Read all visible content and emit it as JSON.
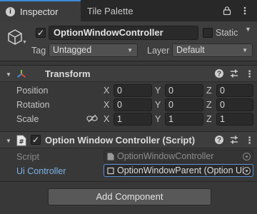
{
  "tabs": {
    "inspector": "Inspector",
    "tile_palette": "Tile Palette"
  },
  "gameobject": {
    "active": true,
    "name": "OptionWindowController",
    "static_label": "Static",
    "static_checked": false,
    "tag_label": "Tag",
    "tag_value": "Untagged",
    "layer_label": "Layer",
    "layer_value": "Default"
  },
  "transform": {
    "title": "Transform",
    "position": {
      "label": "Position",
      "x": "0",
      "y": "0",
      "z": "0"
    },
    "rotation": {
      "label": "Rotation",
      "x": "0",
      "y": "0",
      "z": "0"
    },
    "scale": {
      "label": "Scale",
      "x": "1",
      "y": "1",
      "z": "1"
    },
    "axis": {
      "x": "X",
      "y": "Y",
      "z": "Z"
    }
  },
  "script_component": {
    "enabled": true,
    "title": "Option Window Controller (Script)",
    "script_label": "Script",
    "script_value": "OptionWindowController",
    "ui_controller_label": "Ui Controller",
    "ui_controller_value": "OptionWindowParent (Option Ui"
  },
  "add_component": "Add Component",
  "colors": {
    "accent": "#3c8bd6",
    "link_label": "#7fb2e8",
    "panel": "#383838"
  }
}
